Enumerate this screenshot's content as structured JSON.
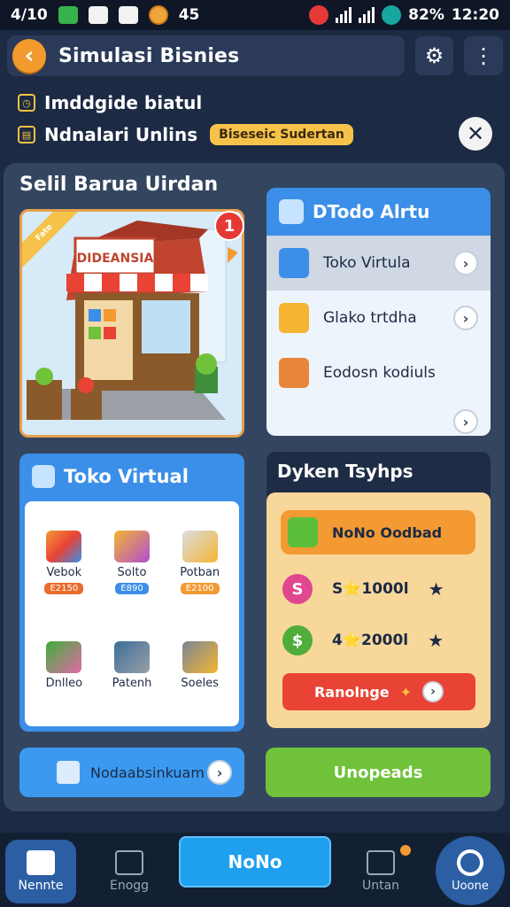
{
  "status_bar": {
    "time_left": "4/10",
    "mid_value": "45",
    "battery": "82%",
    "clock": "12:20"
  },
  "header": {
    "back_icon": "chevron-left-icon",
    "title": "Simulasi Bisnies",
    "settings_icon": "gear-icon",
    "more_icon": "more-vertical-icon"
  },
  "info": {
    "line1": "Imddgide biatul",
    "line2": "Ndnalari Unlins",
    "badge": "Biseseic Sudertan"
  },
  "section_title": "Selil Barua Uirdan",
  "shop": {
    "sign": "DIDEANSIA",
    "badge": "1",
    "ribbon": "Fate"
  },
  "dropdown": {
    "title": "DTodo Alrtu",
    "items": [
      {
        "label": "Toko Virtula",
        "icon": "cube-blue-icon"
      },
      {
        "label": "Glako trtdha",
        "icon": "cube-yellow-icon"
      },
      {
        "label": "Eodosn kodiuls",
        "icon": "books-icon"
      }
    ]
  },
  "toko": {
    "title": "Toko Virtual",
    "tiles": [
      {
        "label": "Vebok",
        "tag": "E2150",
        "tag_color": "#e86c2c"
      },
      {
        "label": "Solto",
        "tag": "E890",
        "tag_color": "#3b8fe8"
      },
      {
        "label": "Potban",
        "tag": "E2100",
        "tag_color": "#f39a33"
      },
      {
        "label": "Dnlleo",
        "tag": "",
        "tag_color": ""
      },
      {
        "label": "Patenh",
        "tag": "",
        "tag_color": ""
      },
      {
        "label": "Soeles",
        "tag": "",
        "tag_color": ""
      }
    ]
  },
  "stats": {
    "title": "Dyken Tsyhps",
    "top_button": "NoNo Oodbad",
    "row1": {
      "icon": "S",
      "value": "S⭐1000l"
    },
    "row2": {
      "icon": "$",
      "value": "4⭐2000l"
    },
    "red_button": "Ranolnge"
  },
  "actions": {
    "blue": "Nodaabsinkuam",
    "green": "Unopeads"
  },
  "bottom_nav": {
    "home": "Nennte",
    "second": "Enogg",
    "center": "NoNo",
    "fourth": "Untan",
    "right": "Uoone"
  },
  "colors": {
    "background": "#1c2a44",
    "panel": "#34465f",
    "accent_blue": "#3b8fe8",
    "accent_orange": "#f39a33",
    "accent_green": "#6fc23a",
    "accent_red": "#e94336"
  }
}
